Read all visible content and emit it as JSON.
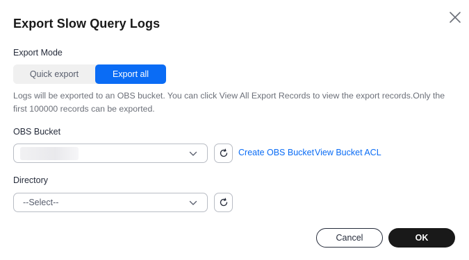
{
  "dialog": {
    "title": "Export Slow Query Logs",
    "close_icon": "close-icon"
  },
  "export_mode": {
    "label": "Export Mode",
    "options": [
      "Quick export",
      "Export all"
    ],
    "selected": "Export all"
  },
  "info_text": "Logs will be exported to an OBS bucket. You can click View All Export Records to view the export records.Only the first 100000 records can be exported.",
  "obs_bucket": {
    "label": "OBS Bucket",
    "value": "",
    "create_link": "Create OBS Bucket",
    "acl_link": "View Bucket ACL",
    "refresh_icon": "refresh-icon",
    "chevron_icon": "chevron-down-icon"
  },
  "directory": {
    "label": "Directory",
    "placeholder": "--Select--",
    "refresh_icon": "refresh-icon",
    "chevron_icon": "chevron-down-icon"
  },
  "footer": {
    "cancel_label": "Cancel",
    "ok_label": "OK"
  },
  "colors": {
    "accent": "#0a6cf5",
    "primary_button": "#191919",
    "text": "#191919",
    "muted_text": "#6b6f78"
  }
}
